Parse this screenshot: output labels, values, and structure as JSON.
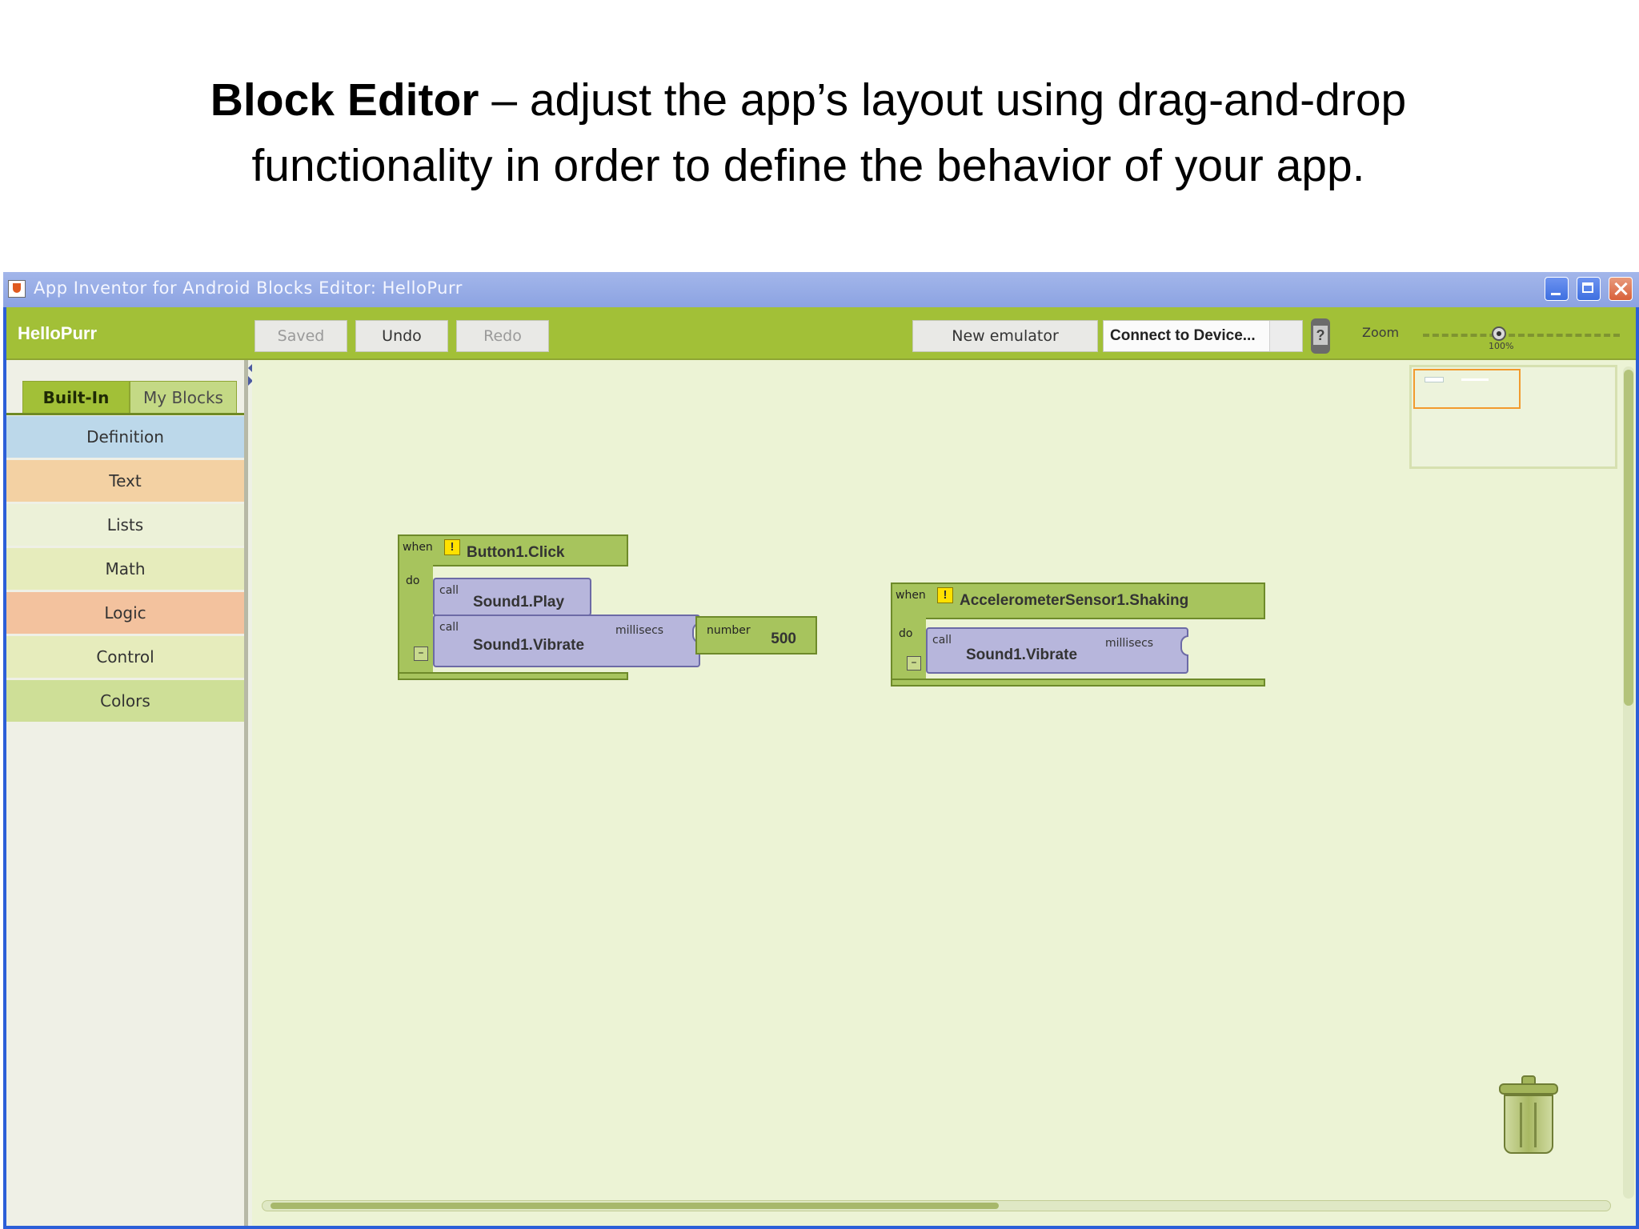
{
  "slide": {
    "title_bold": "Block Editor",
    "title_rest_line1": " – adjust the app’s layout using drag-and-drop",
    "title_line2": "functionality in order to define the behavior of your app."
  },
  "window": {
    "title": "App Inventor for Android Blocks Editor: HelloPurr",
    "controls": [
      "minimize",
      "maximize",
      "close"
    ]
  },
  "toolbar": {
    "project_name": "HelloPurr",
    "saved_label": "Saved",
    "undo_label": "Undo",
    "redo_label": "Redo",
    "new_emulator_label": "New emulator",
    "connect_label": "Connect to Device...",
    "help_glyph": "?",
    "zoom_label": "Zoom",
    "zoom_value": "100%"
  },
  "drawers": {
    "tabs": [
      {
        "label": "Built-In",
        "active": true
      },
      {
        "label": "My Blocks",
        "active": false
      }
    ],
    "items": [
      {
        "label": "Definition",
        "color": "#bcd8ea"
      },
      {
        "label": "Text",
        "color": "#f3d1a3"
      },
      {
        "label": "Lists",
        "color": "#ecf1d8"
      },
      {
        "label": "Math",
        "color": "#e6ecbc"
      },
      {
        "label": "Logic",
        "color": "#f3c29e"
      },
      {
        "label": "Control",
        "color": "#e6ecbc"
      },
      {
        "label": "Colors",
        "color": "#cedf97"
      }
    ]
  },
  "blocks": {
    "button_click": {
      "when": "when",
      "warning": "!",
      "event": "Button1.Click",
      "do": "do",
      "collapse": "–",
      "call_play": {
        "kw": "call",
        "name": "Sound1.Play"
      },
      "call_vibrate": {
        "kw": "call",
        "name": "Sound1.Vibrate",
        "param": "millisecs"
      },
      "number": {
        "kw": "number",
        "value": "500"
      }
    },
    "shaking": {
      "when": "when",
      "warning": "!",
      "event": "AccelerometerSensor1.Shaking",
      "do": "do",
      "collapse": "–",
      "call_vibrate": {
        "kw": "call",
        "name": "Sound1.Vibrate",
        "param": "millisecs"
      }
    }
  },
  "icons": [
    "java-app-icon",
    "help-phone-icon",
    "trash-icon"
  ],
  "colors": {
    "toolbar": "#a2c037",
    "workspace": "#ecf3d5",
    "event_block": "#a7c45d",
    "call_block": "#b7b6dc",
    "titlebar": "#8ca3e2"
  }
}
